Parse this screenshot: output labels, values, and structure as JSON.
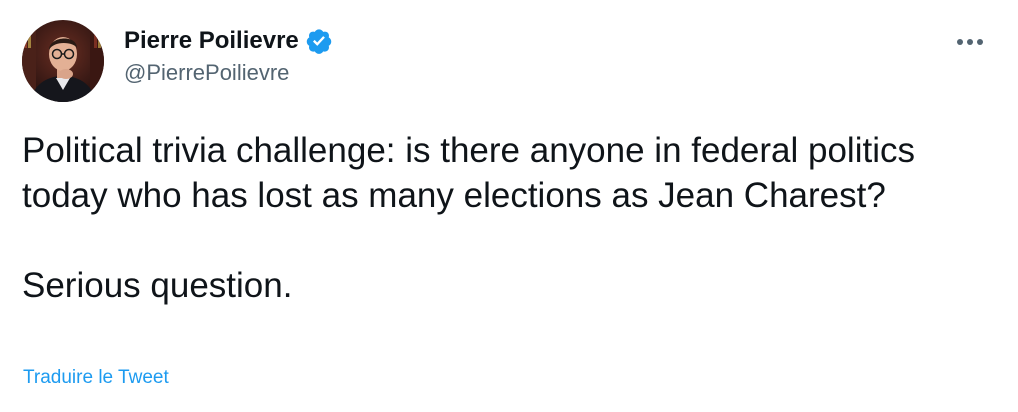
{
  "author": {
    "display_name": "Pierre Poilievre",
    "handle": "@PierrePoilievre",
    "verified": true,
    "verified_color": "#1d9bf0",
    "avatar_icon": "profile-photo"
  },
  "menu": {
    "more_icon": "more-horizontal-icon"
  },
  "tweet": {
    "paragraph_1": "Political trivia challenge: is there anyone in federal politics today who has lost as many elections as Jean Charest?",
    "paragraph_2": "Serious question."
  },
  "translate": {
    "label": "Traduire le Tweet",
    "color": "#1d9bf0"
  }
}
